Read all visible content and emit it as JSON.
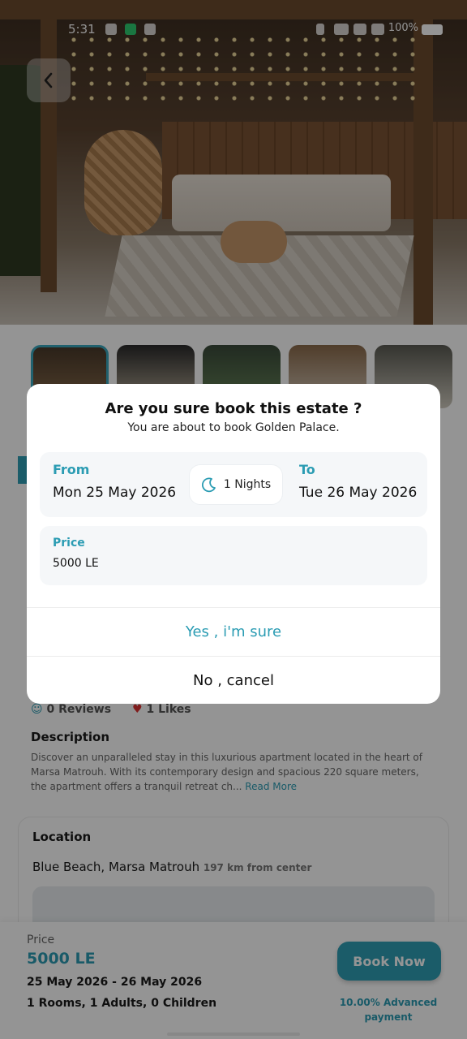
{
  "status_bar": {
    "time": "5:31",
    "battery": "100%"
  },
  "hero": {
    "back_icon": "chevron-left-icon"
  },
  "stats": {
    "reviews": "0 Reviews",
    "likes": "1 Likes"
  },
  "description": {
    "title": "Description",
    "text": "Discover an unparalleled stay in this luxurious apartment located in the heart of Marsa Matrouh. With its contemporary design and spacious 220 square meters, the apartment offers a tranquil retreat ch... ",
    "read_more": "Read More"
  },
  "location": {
    "title": "Location",
    "place": "Blue Beach,  Marsa Matrouh ",
    "distance": "197 km from center"
  },
  "bottom_bar": {
    "price_label": "Price",
    "price": "5000 LE",
    "dates": "25 May 2026 - 26 May 2026",
    "rooms": "1 Rooms, 1 Adults, 0 Children",
    "book_label": "Book Now",
    "advance": "10.00% Advanced payment"
  },
  "dialog": {
    "title": "Are you sure book this estate ?",
    "subtitle": "You are about to book Golden Palace.",
    "from_label": "From",
    "from_value": "Mon 25 May 2026",
    "nights": "1 Nights",
    "to_label": "To",
    "to_value": "Tue 26 May 2026",
    "price_label": "Price",
    "price_value": "5000 LE",
    "confirm_label": "Yes , i'm sure",
    "cancel_label": "No , cancel"
  },
  "colors": {
    "accent": "#2b9cb3",
    "button": "#2f9fb6",
    "like": "#d33333"
  }
}
